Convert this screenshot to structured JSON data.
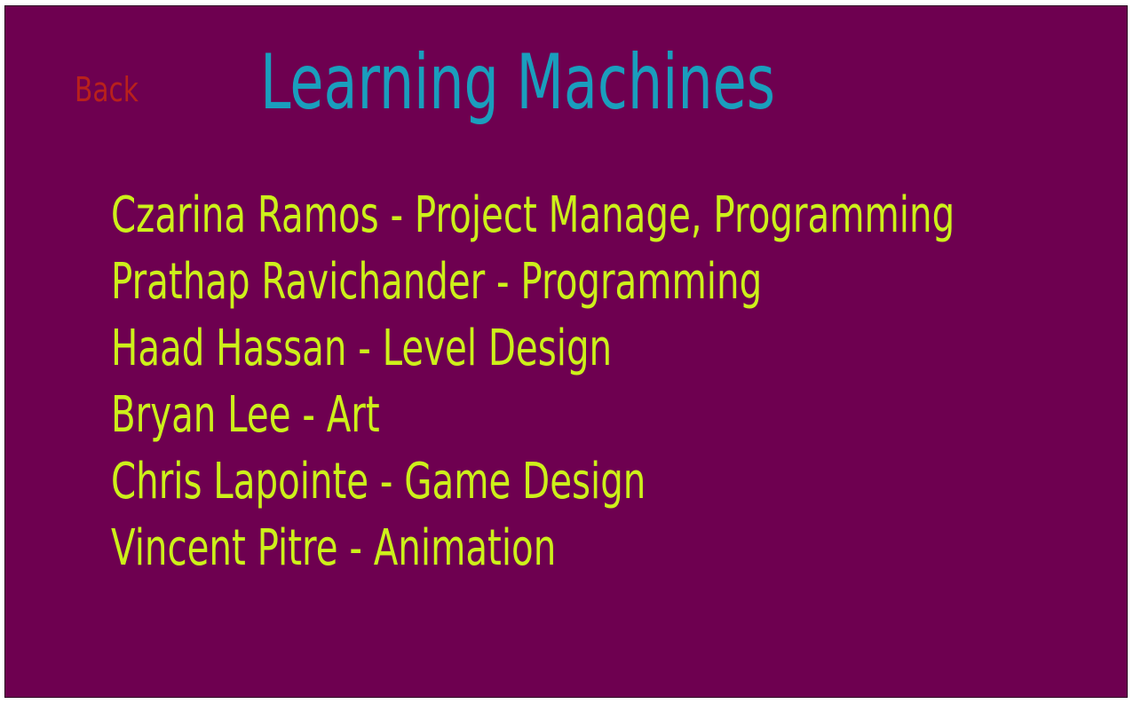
{
  "nav": {
    "back_label": "Back"
  },
  "header": {
    "title": "Learning Machines"
  },
  "credits": [
    "Czarina Ramos - Project Manage, Programming",
    "Prathap Ravichander - Programming",
    "Haad Hassan - Level Design",
    "Bryan Lee - Art",
    "Chris Lapointe - Game Design",
    "Vincent Pitre - Animation"
  ],
  "colors": {
    "background": "#6e0050",
    "title": "#1a9ebd",
    "back": "#b8211c",
    "credits": "#cdf01a"
  }
}
